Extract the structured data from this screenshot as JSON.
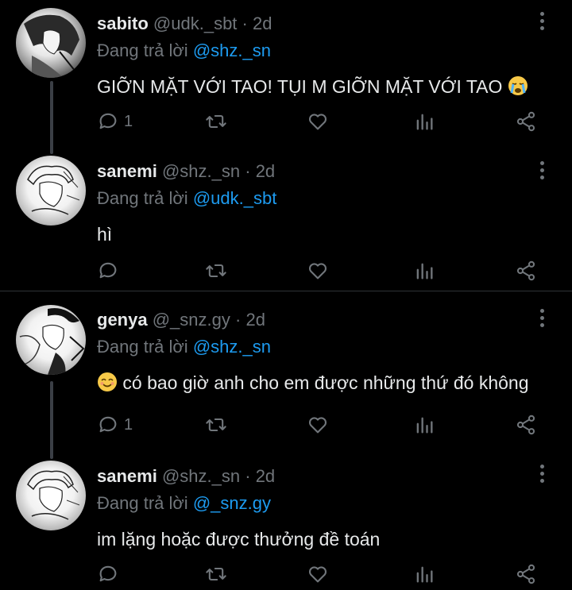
{
  "tweets": [
    {
      "name": "sabito",
      "handle": "@udk._sbt",
      "time": "2d",
      "reply_prefix": "Đang trả lời",
      "reply_to": "@shz._sn",
      "text": "GIỠN MẶT VỚI TAO! TỤI M GIỠN MẶT VỚI TAO",
      "emoji": "crying-face",
      "reply_count": "1"
    },
    {
      "name": "sanemi",
      "handle": "@shz._sn",
      "time": "2d",
      "reply_prefix": "Đang trả lời",
      "reply_to": "@udk._sbt",
      "text": "hì",
      "reply_count": ""
    },
    {
      "name": "genya",
      "handle": "@_snz.gy",
      "time": "2d",
      "reply_prefix": "Đang trả lời",
      "reply_to": "@shz._sn",
      "text": "có bao giờ anh cho em được những thứ đó không",
      "emoji": "smiling-face",
      "reply_count": "1"
    },
    {
      "name": "sanemi",
      "handle": "@shz._sn",
      "time": "2d",
      "reply_prefix": "Đang trả lời",
      "reply_to": "@_snz.gy",
      "text": "im lặng hoặc được thưởng đề toán",
      "reply_count": ""
    }
  ],
  "separator": "·",
  "colors": {
    "background": "#000000",
    "text": "#e7e9ea",
    "muted": "#71767b",
    "mention": "#1d9bf0",
    "thread_line": "#3b3f45"
  },
  "icons": [
    "reply-icon",
    "retweet-icon",
    "like-icon",
    "views-icon",
    "share-icon",
    "more-icon"
  ]
}
